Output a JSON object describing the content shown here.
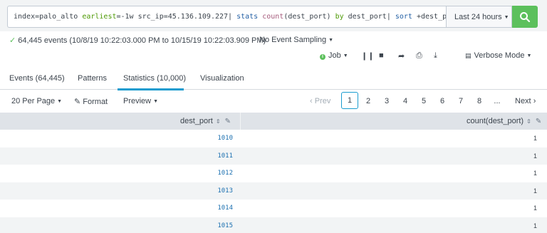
{
  "search": {
    "query_parts": [
      {
        "text": "index=palo_alto ",
        "cls": ""
      },
      {
        "text": "earliest",
        "cls": "tok-kw"
      },
      {
        "text": "=-1w src_ip=45.136.109.227| ",
        "cls": ""
      },
      {
        "text": "stats ",
        "cls": "tok-cmd"
      },
      {
        "text": "count",
        "cls": "tok-fn"
      },
      {
        "text": "(dest_port) ",
        "cls": ""
      },
      {
        "text": "by",
        "cls": "tok-kw"
      },
      {
        "text": " dest_port| ",
        "cls": ""
      },
      {
        "text": "sort",
        "cls": "tok-cmd"
      },
      {
        "text": " +dest_port",
        "cls": ""
      }
    ],
    "time_range": "Last 24 hours"
  },
  "status": {
    "events_summary": "64,445 events (10/8/19 10:22:03.000 PM to 10/15/19 10:22:03.909 PM)",
    "sampling": "No Event Sampling"
  },
  "job_bar": {
    "job_label": "Job",
    "verbose_mode": "Verbose Mode"
  },
  "tabs": [
    {
      "label": "Events (64,445)"
    },
    {
      "label": "Patterns"
    },
    {
      "label": "Statistics (10,000)"
    },
    {
      "label": "Visualization"
    }
  ],
  "controls": {
    "per_page": "20 Per Page",
    "format": "Format",
    "preview": "Preview"
  },
  "pager": {
    "prev": "Prev",
    "pages": [
      "1",
      "2",
      "3",
      "4",
      "5",
      "6",
      "7",
      "8"
    ],
    "ellipsis": "...",
    "next": "Next",
    "current": "1"
  },
  "table": {
    "headers": [
      "dest_port",
      "count(dest_port)"
    ],
    "rows": [
      {
        "dest_port": "1010",
        "count": "1"
      },
      {
        "dest_port": "1011",
        "count": "1"
      },
      {
        "dest_port": "1012",
        "count": "1"
      },
      {
        "dest_port": "1013",
        "count": "1"
      },
      {
        "dest_port": "1014",
        "count": "1"
      },
      {
        "dest_port": "1015",
        "count": "1"
      }
    ]
  },
  "colors": {
    "accent": "#1a9ccf",
    "search_button": "#5cc05c",
    "link": "#1a6fb0"
  }
}
